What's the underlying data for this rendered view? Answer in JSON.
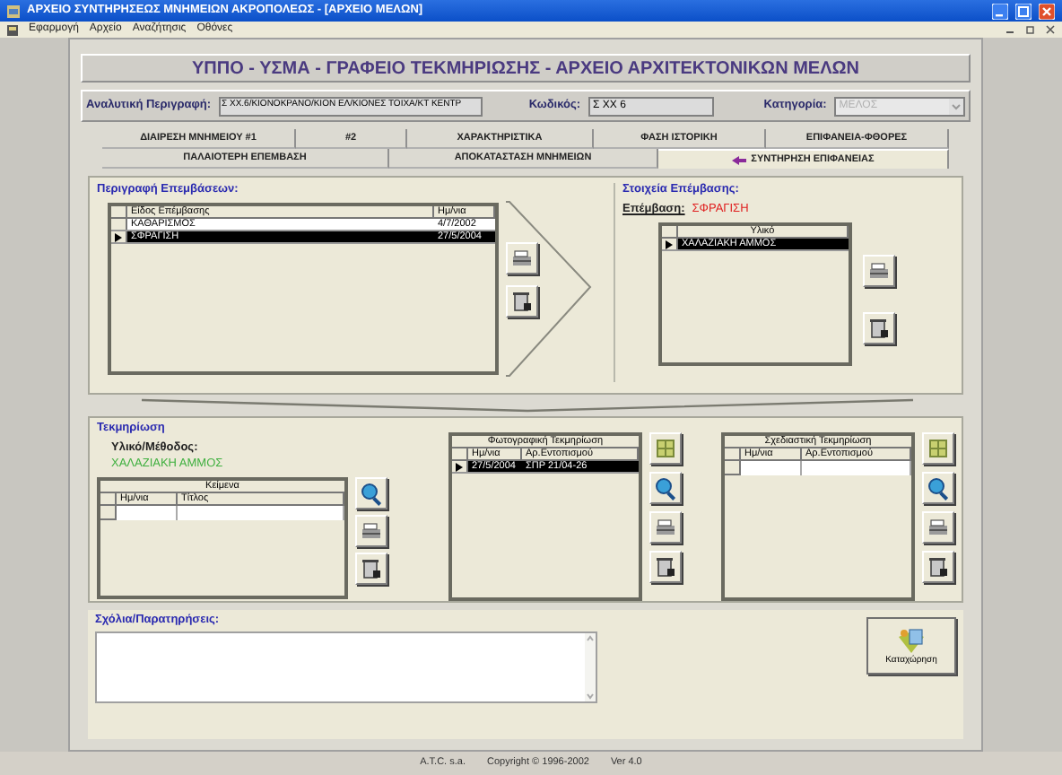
{
  "window": {
    "title": "ΑΡΧΕΙΟ ΣΥΝΤΗΡΗΣΕΩΣ ΜΝΗΜΕΙΩΝ ΑΚΡΟΠΟΛΕΩΣ - [ΑΡΧΕΙΟ ΜΕΛΩΝ]"
  },
  "menu": [
    "Εφαρμογή",
    "Αρχείο",
    "Αναζήτησις",
    "Οθόνες"
  ],
  "banner": "ΥΠΠΟ - ΥΣΜΑ - ΓΡΑΦΕΙΟ ΤΕΚΜΗΡΙΩΣΗΣ - ΑΡΧΕΙΟ ΑΡΧΙΤΕΚΤΟΝΙΚΩΝ ΜΕΛΩΝ",
  "fields": {
    "description_label": "Αναλυτική Περιγραφή:",
    "description_value": "Σ ΧΧ.6/ΚΙΟΝΟΚΡΑΝΟ/ΚΙΟΝ ΕΛ/ΚΙΟΝΕΣ ΤΟΙΧΑ/ΚΤ ΚΕΝΤΡ",
    "code_label": "Κωδικός:",
    "code_value": "Σ ΧΧ 6",
    "category_label": "Κατηγορία:",
    "category_value": "ΜΕΛΟΣ",
    "category_disabled": true
  },
  "tab_rows": [
    {
      "tabs": [
        {
          "label": "ΔΙΑΙΡΕΣΗ ΜΝΗΜΕΙΟΥ #1",
          "selected": false
        },
        {
          "label": "#2",
          "selected": false
        },
        {
          "label": "ΧΑΡΑΚΤΗΡΙΣΤΙΚΑ",
          "selected": false
        },
        {
          "label": "ΦΑΣΗ ΙΣΤΟΡΙΚΗ",
          "selected": false
        },
        {
          "label": "ΕΠΙΦΑΝΕΙΑ-ΦΘΟΡΕΣ",
          "selected": false
        }
      ]
    },
    {
      "tabs": [
        {
          "label": "ΠΑΛΑΙΟΤΕΡΗ ΕΠΕΜΒΑΣΗ",
          "selected": false
        },
        {
          "label": "ΑΠΟΚΑΤΑΣΤΑΣΗ ΜΝΗΜΕΙΩΝ",
          "selected": false
        },
        {
          "label": "ΣΥΝΤΗΡΗΣΗ ΕΠΙΦΑΝΕΙΑΣ",
          "selected": true
        }
      ]
    }
  ],
  "interventions": {
    "title": "Περιγραφή Επεμβάσεων:",
    "table": {
      "columns": [
        "Είδος Επέμβασης",
        "Ημ/νια"
      ],
      "rows": [
        {
          "cells": [
            "ΚΑΘΑΡΙΣΜΟΣ",
            "4/7/2002"
          ],
          "selected": false
        },
        {
          "cells": [
            "ΣΦΡΑΓΙΣΗ",
            "27/5/2004"
          ],
          "selected": true
        }
      ]
    }
  },
  "intervention_details": {
    "title": "Στοιχεία Επέμβασης:",
    "label": "Επέμβαση:",
    "value": "ΣΦΡΑΓΙΣΗ",
    "table": {
      "columns": [
        "Υλικό"
      ],
      "rows": [
        {
          "cells": [
            "ΧΑΛΑΖΙΑΚΗ ΑΜΜΟΣ"
          ],
          "selected": true
        }
      ]
    }
  },
  "documentation": {
    "title": "Τεκμηρίωση",
    "material_label": "Υλικό/Μέθοδος:",
    "material_value": "ΧΑΛΑΖΙΑΚΗ ΑΜΜΟΣ",
    "texts": {
      "caption": "Κείμενα",
      "columns": [
        "Ημ/νια",
        "Τίτλος"
      ],
      "blank_row": true
    },
    "photos": {
      "caption": "Φωτογραφική Τεκμηρίωση",
      "columns": [
        "Ημ/νια",
        "Αρ.Εντοπισμού"
      ],
      "rows": [
        {
          "cells": [
            "27/5/2004",
            "ΣΠΡ 21/04-26"
          ],
          "selected": true
        }
      ]
    },
    "drawings": {
      "caption": "Σχεδιαστική Τεκμηρίωση",
      "columns": [
        "Ημ/νια",
        "Αρ.Εντοπισμού"
      ],
      "blank_row": true
    }
  },
  "comments": {
    "label": "Σχόλια/Παρατηρήσεις:"
  },
  "save_button": "Καταχώρηση",
  "status_bar": [
    "A.T.C. s.a.",
    "Copyright © 1996-2002",
    "Ver 4.0"
  ]
}
